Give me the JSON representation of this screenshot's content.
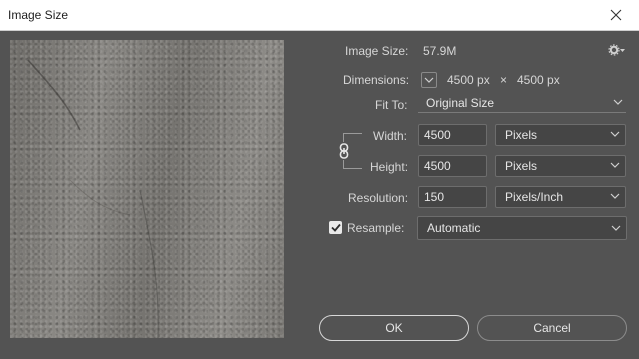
{
  "window": {
    "title": "Image Size",
    "close_icon": "close-icon"
  },
  "info": {
    "image_size_label": "Image Size:",
    "image_size_value": "57.9M",
    "dimensions_label": "Dimensions:",
    "dimensions_width": "4500 px",
    "dimensions_times": "×",
    "dimensions_height": "4500 px"
  },
  "fit_to": {
    "label": "Fit To:",
    "value": "Original Size"
  },
  "width": {
    "label": "Width:",
    "value": "4500",
    "unit": "Pixels"
  },
  "height": {
    "label": "Height:",
    "value": "4500",
    "unit": "Pixels"
  },
  "resolution": {
    "label": "Resolution:",
    "value": "150",
    "unit": "Pixels/Inch"
  },
  "resample": {
    "label": "Resample:",
    "checked": true,
    "value": "Automatic"
  },
  "buttons": {
    "ok": "OK",
    "cancel": "Cancel"
  },
  "icons": [
    "gear-icon",
    "chevron-down-icon",
    "link-icon",
    "close-icon",
    "checkmark-icon"
  ],
  "colors": {
    "background": "#535353",
    "field": "#454545",
    "titlebar": "#ffffff"
  }
}
